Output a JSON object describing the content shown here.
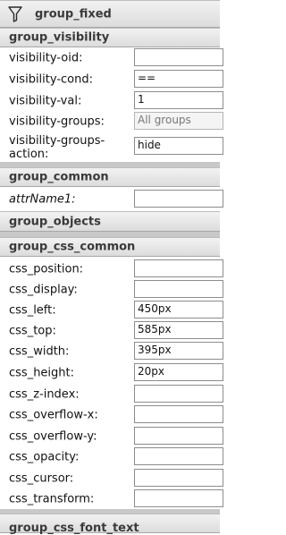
{
  "sections": {
    "fixed": "group_fixed",
    "visibility": "group_visibility",
    "common": "group_common",
    "objects": "group_objects",
    "css_common": "group_css_common",
    "css_font_text": "group_css_font_text"
  },
  "visibility_fields": [
    {
      "label": "visibility-oid:",
      "value": ""
    },
    {
      "label": "visibility-cond:",
      "value": "=="
    },
    {
      "label": "visibility-val:",
      "value": "1"
    },
    {
      "label": "visibility-groups:",
      "value": "All groups"
    },
    {
      "label": "visibility-groups-action:",
      "value": "hide"
    }
  ],
  "common_fields": [
    {
      "label": "attrName1:",
      "value": ""
    }
  ],
  "css_fields": [
    {
      "label": "css_position:",
      "value": ""
    },
    {
      "label": "css_display:",
      "value": ""
    },
    {
      "label": "css_left:",
      "value": "450px"
    },
    {
      "label": "css_top:",
      "value": "585px"
    },
    {
      "label": "css_width:",
      "value": "395px"
    },
    {
      "label": "css_height:",
      "value": "20px"
    },
    {
      "label": "css_z-index:",
      "value": ""
    },
    {
      "label": "css_overflow-x:",
      "value": ""
    },
    {
      "label": "css_overflow-y:",
      "value": ""
    },
    {
      "label": "css_opacity:",
      "value": ""
    },
    {
      "label": "css_cursor:",
      "value": ""
    },
    {
      "label": "css_transform:",
      "value": ""
    }
  ]
}
